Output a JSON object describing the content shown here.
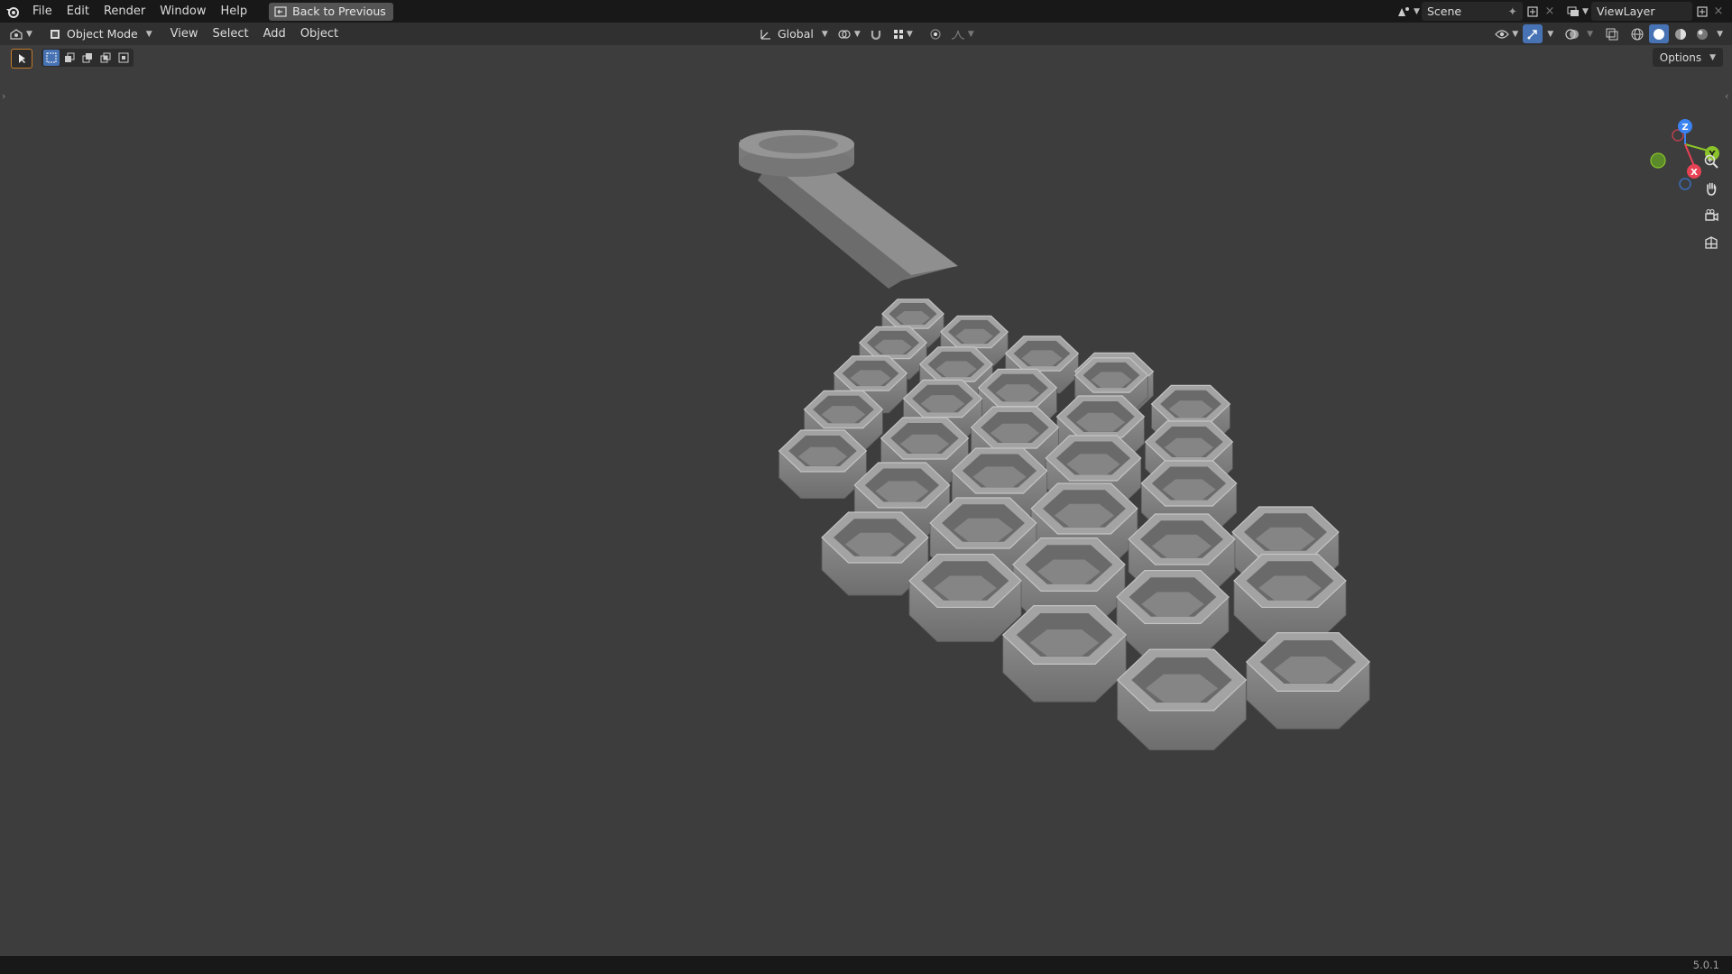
{
  "menu": [
    "File",
    "Edit",
    "Render",
    "Window",
    "Help"
  ],
  "back_button": "Back to Previous",
  "scene": "Scene",
  "view_layer": "ViewLayer",
  "mode": "Object Mode",
  "view_menu": [
    "View",
    "Select",
    "Add",
    "Object"
  ],
  "transform_orientation": "Global",
  "options": "Options",
  "version": "5.0.1",
  "gizmo_labels": {
    "z": "Z",
    "y": "Y",
    "x": "X"
  },
  "icons": {
    "logo": "blender-logo-icon",
    "back": "back-screen-icon",
    "scene": "scene-icon",
    "pin": "pin-icon",
    "new_scene": "new-scene-icon",
    "remove": "close-icon",
    "view_layer": "view-layer-icon",
    "editor": "editor-type-icon",
    "mode": "object-mode-icon",
    "transform": "orientation-axes-icon",
    "pivot": "pivot-point-icon",
    "snap": "snap-magnet-icon",
    "snap_target": "snap-increment-icon",
    "proportional": "proportional-edit-icon",
    "falloff": "falloff-curve-icon",
    "visibility": "selectability-eye-icon",
    "gizmo": "gizmo-toggle-icon",
    "overlay": "overlays-icon",
    "xray": "xray-toggle-icon",
    "shading": [
      "wireframe-shading-icon",
      "solid-shading-icon",
      "material-shading-icon",
      "rendered-shading-icon"
    ],
    "zoom": "zoom-icon",
    "pan": "hand-pan-icon",
    "camera": "camera-view-icon",
    "ortho": "ortho-grid-icon"
  },
  "colors": {
    "background": "#3d3d3d",
    "topbar": "#181818",
    "header": "#303030",
    "accent": "#4772b3",
    "axis_x": "#e84255",
    "axis_y": "#8bc42a",
    "axis_z": "#3b83f0",
    "model": "#8c8c8c"
  }
}
